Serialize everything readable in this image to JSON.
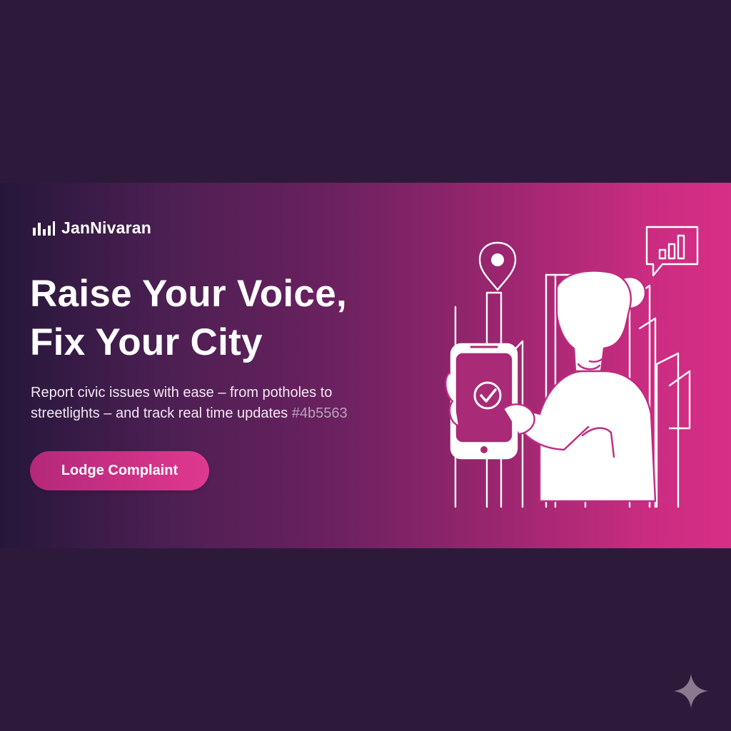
{
  "brand": {
    "name": "JanNivaran",
    "logo_icon": "bar-chart-icon"
  },
  "hero": {
    "headline_line1": "Raise Your Voice,",
    "headline_line2": "Fix Your City",
    "subtext_line1": "Report civic issues with ease – from potholes to",
    "subtext_line2": "streetlights – and track real time updates",
    "subtext_code": "#4b5563",
    "cta_label": "Lodge Complaint"
  },
  "illustration": {
    "icons": [
      "location-pin-icon",
      "chat-bar-chart-icon",
      "city-buildings-icon",
      "person-with-phone-icon",
      "checkmark-icon"
    ]
  },
  "colors": {
    "page_background": "#2d1a3b",
    "banner_gradient_start": "#25173a",
    "banner_gradient_end": "#d72e86",
    "accent_pink": "#e0388f",
    "text_white": "#ffffff"
  }
}
